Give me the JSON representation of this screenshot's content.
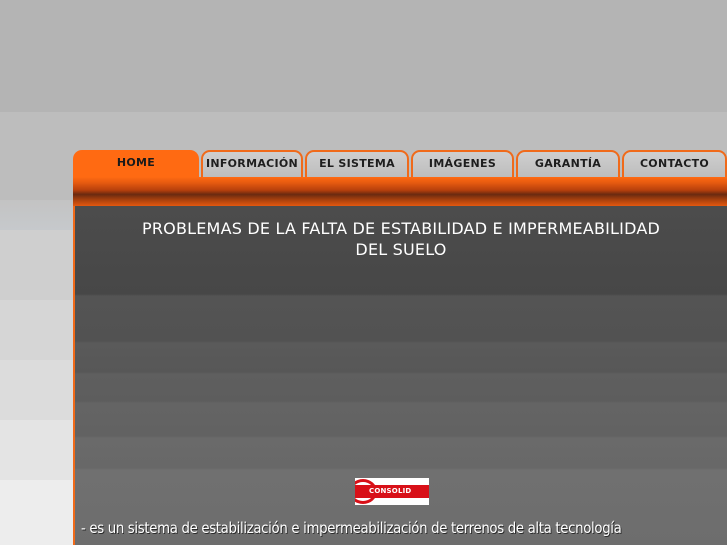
{
  "nav": {
    "tabs": [
      {
        "label": "HOME",
        "active": true
      },
      {
        "label": "INFORMACIÓN",
        "active": false
      },
      {
        "label": "EL SISTEMA",
        "active": false
      },
      {
        "label": "IMÁGENES",
        "active": false
      },
      {
        "label": "GARANTÍA",
        "active": false
      },
      {
        "label": "CONTACTO",
        "active": false
      }
    ]
  },
  "main": {
    "headline_line1": "PROBLEMAS DE LA FALTA DE ESTABILIDAD E IMPERMEABILIDAD",
    "headline_line2": "DEL SUELO",
    "logo_text": "CONSOLID",
    "tagline": "- es un sistema de estabilización e impermeabilización de terrenos de alta tecnología"
  },
  "colors": {
    "accent": "#ff6a12",
    "panel": "#4c4c4c",
    "logo_red": "#d81018"
  }
}
